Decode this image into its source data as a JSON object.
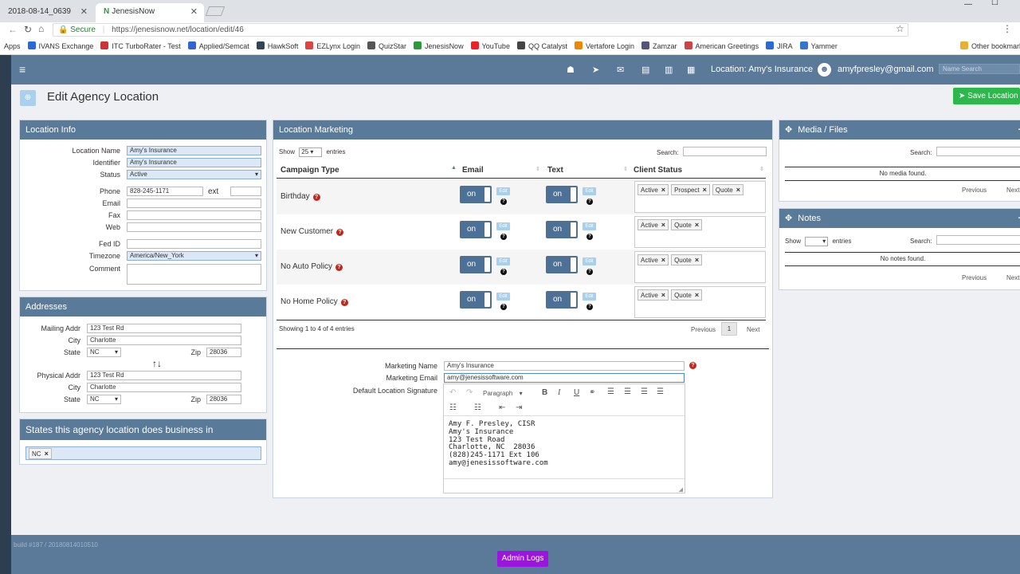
{
  "browser": {
    "tabs": [
      {
        "title": "2018-08-14_0639",
        "active": false
      },
      {
        "title": "JenesisNow",
        "active": true
      }
    ],
    "url_secure_label": "Secure",
    "url": "https://jenesisnow.net/location/edit/46",
    "bookmarks": [
      "Apps",
      "IVANS Exchange",
      "ITC TurboRater - Test",
      "Applied/Semcat",
      "HawkSoft",
      "EZLynx Login",
      "QuizStar",
      "JenesisNow",
      "YouTube",
      "QQ Catalyst",
      "Vertafore Login",
      "Zamzar",
      "American Greetings",
      "JIRA",
      "Yammer",
      "Other bookmarks"
    ]
  },
  "topnav": {
    "location_label": "Location: Amy's Insurance",
    "user_email": "amyfpresley@gmail.com",
    "search_placeholder": "Name Search"
  },
  "page": {
    "title": "Edit Agency Location",
    "save_button": "Save Location"
  },
  "location_info": {
    "header": "Location Info",
    "labels": {
      "name": "Location Name",
      "identifier": "Identifier",
      "status": "Status",
      "phone": "Phone",
      "ext": "ext",
      "email": "Email",
      "fax": "Fax",
      "web": "Web",
      "fed_id": "Fed ID",
      "timezone": "Timezone",
      "comment": "Comment"
    },
    "values": {
      "name": "Amy's Insurance",
      "identifier": "Amy's Insurance",
      "status": "Active",
      "phone": "828-245-1171",
      "timezone": "America/New_York"
    }
  },
  "addresses": {
    "header": "Addresses",
    "labels": {
      "mailing": "Mailing Addr",
      "physical": "Physical Addr",
      "city": "City",
      "state": "State",
      "zip": "Zip"
    },
    "mailing": {
      "addr": "123 Test Rd",
      "city": "Charlotte",
      "state": "NC",
      "zip": "28036"
    },
    "physical": {
      "addr": "123 Test Rd",
      "city": "Charlotte",
      "state": "NC",
      "zip": "28036"
    }
  },
  "states": {
    "header": "States this agency location does business in",
    "tags": [
      "NC"
    ]
  },
  "marketing": {
    "header": "Location Marketing",
    "show_label": "Show",
    "entries_count": "25",
    "entries_label": "entries",
    "search_label": "Search:",
    "columns": [
      "Campaign Type",
      "Email",
      "Text",
      "Client Status"
    ],
    "toggle_label": "on",
    "edit_label": "Edit",
    "rows": [
      {
        "type": "Birthday",
        "statuses": [
          "Active",
          "Prospect",
          "Quote"
        ]
      },
      {
        "type": "New Customer",
        "statuses": [
          "Active",
          "Quote"
        ]
      },
      {
        "type": "No Auto Policy",
        "statuses": [
          "Active",
          "Quote"
        ]
      },
      {
        "type": "No Home Policy",
        "statuses": [
          "Active",
          "Quote"
        ]
      }
    ],
    "showing": "Showing 1 to 4 of 4 entries",
    "previous": "Previous",
    "page": "1",
    "next": "Next",
    "labels": {
      "name": "Marketing Name",
      "email": "Marketing Email",
      "signature": "Default Location Signature"
    },
    "name": "Amy's Insurance",
    "email": "amy@jenesissoftware.com",
    "editor_format": "Paragraph",
    "signature_lines": [
      "Amy F. Presley, CISR",
      "Amy's Insurance",
      "123 Test Road",
      "Charlotte, NC  28036",
      "(828)245-1171 Ext 106",
      "amy@jenesissoftware.com"
    ]
  },
  "media": {
    "header": "Media / Files",
    "search_label": "Search:",
    "empty": "No media found.",
    "previous": "Previous",
    "next": "Next"
  },
  "notes": {
    "header": "Notes",
    "show_label": "Show",
    "entries_label": "entries",
    "search_label": "Search:",
    "empty": "No notes found.",
    "previous": "Previous",
    "next": "Next"
  },
  "footer": {
    "build": "build #187 / 20180814010510",
    "admin_logs": "Admin Logs"
  },
  "colors": {
    "nav": "#5b7a9a",
    "panel_header": "#5a7a9a",
    "save_green": "#2db84b",
    "admin_purple": "#9b14e0",
    "toggle": "#4d7096"
  }
}
